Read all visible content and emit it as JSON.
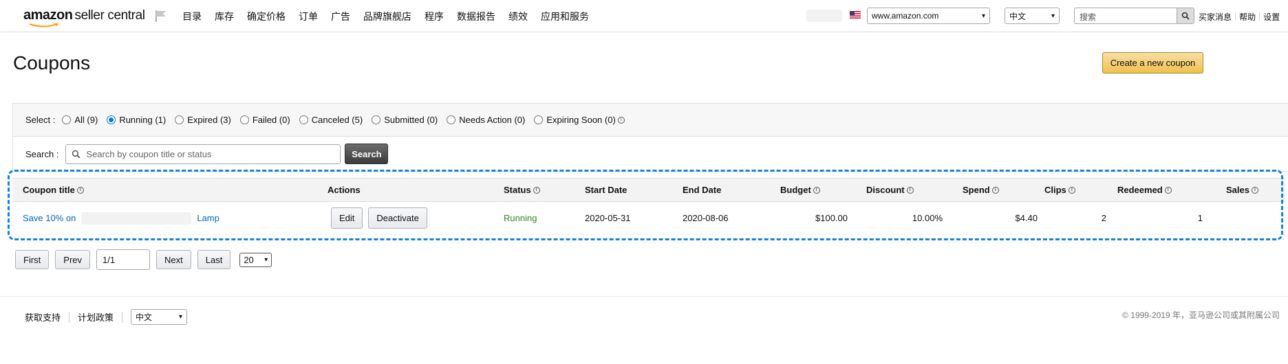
{
  "brand": {
    "logo_primary": "amazon",
    "logo_secondary": "seller central"
  },
  "nav": {
    "menu": [
      "目录",
      "库存",
      "确定价格",
      "订单",
      "广告",
      "品牌旗舰店",
      "程序",
      "数据报告",
      "绩效",
      "应用和服务"
    ],
    "marketplace": "www.amazon.com",
    "language": "中文",
    "search_placeholder": "搜索",
    "links": [
      "买家消息",
      "帮助",
      "设置"
    ]
  },
  "page": {
    "title": "Coupons",
    "create_button": "Create a new coupon"
  },
  "filters": {
    "label": "Select :",
    "options": [
      {
        "label": "All (9)",
        "checked": false
      },
      {
        "label": "Running (1)",
        "checked": true
      },
      {
        "label": "Expired (3)",
        "checked": false
      },
      {
        "label": "Failed (0)",
        "checked": false
      },
      {
        "label": "Canceled (5)",
        "checked": false
      },
      {
        "label": "Submitted (0)",
        "checked": false
      },
      {
        "label": "Needs Action (0)",
        "checked": false
      },
      {
        "label": "Expiring Soon (0)",
        "checked": false
      }
    ]
  },
  "search": {
    "label": "Search :",
    "placeholder": "Search by coupon title or status",
    "button": "Search"
  },
  "table": {
    "headers": {
      "coupon_title": "Coupon title",
      "actions": "Actions",
      "status": "Status",
      "start_date": "Start Date",
      "end_date": "End Date",
      "budget": "Budget",
      "discount": "Discount",
      "spend": "Spend",
      "clips": "Clips",
      "redeemed": "Redeemed",
      "sales": "Sales"
    },
    "row": {
      "title_prefix": "Save 10% on",
      "title_suffix": "Lamp",
      "edit": "Edit",
      "deactivate": "Deactivate",
      "status": "Running",
      "start_date": "2020-05-31",
      "end_date": "2020-08-06",
      "budget": "$100.00",
      "discount": "10.00%",
      "spend": "$4.40",
      "clips": "2",
      "redeemed": "1"
    }
  },
  "pager": {
    "first": "First",
    "prev": "Prev",
    "page": "1/1",
    "next": "Next",
    "last": "Last",
    "page_size": "20"
  },
  "footer": {
    "links": [
      "获取支持",
      "计划政策"
    ],
    "language": "中文",
    "copyright": "© 1999-2019 年，亚马逊公司或其附属公司"
  },
  "colors": {
    "accent": "#1482e0",
    "link": "#0066c0",
    "running": "#2e8b1f",
    "create_button": "#f0c14b"
  }
}
